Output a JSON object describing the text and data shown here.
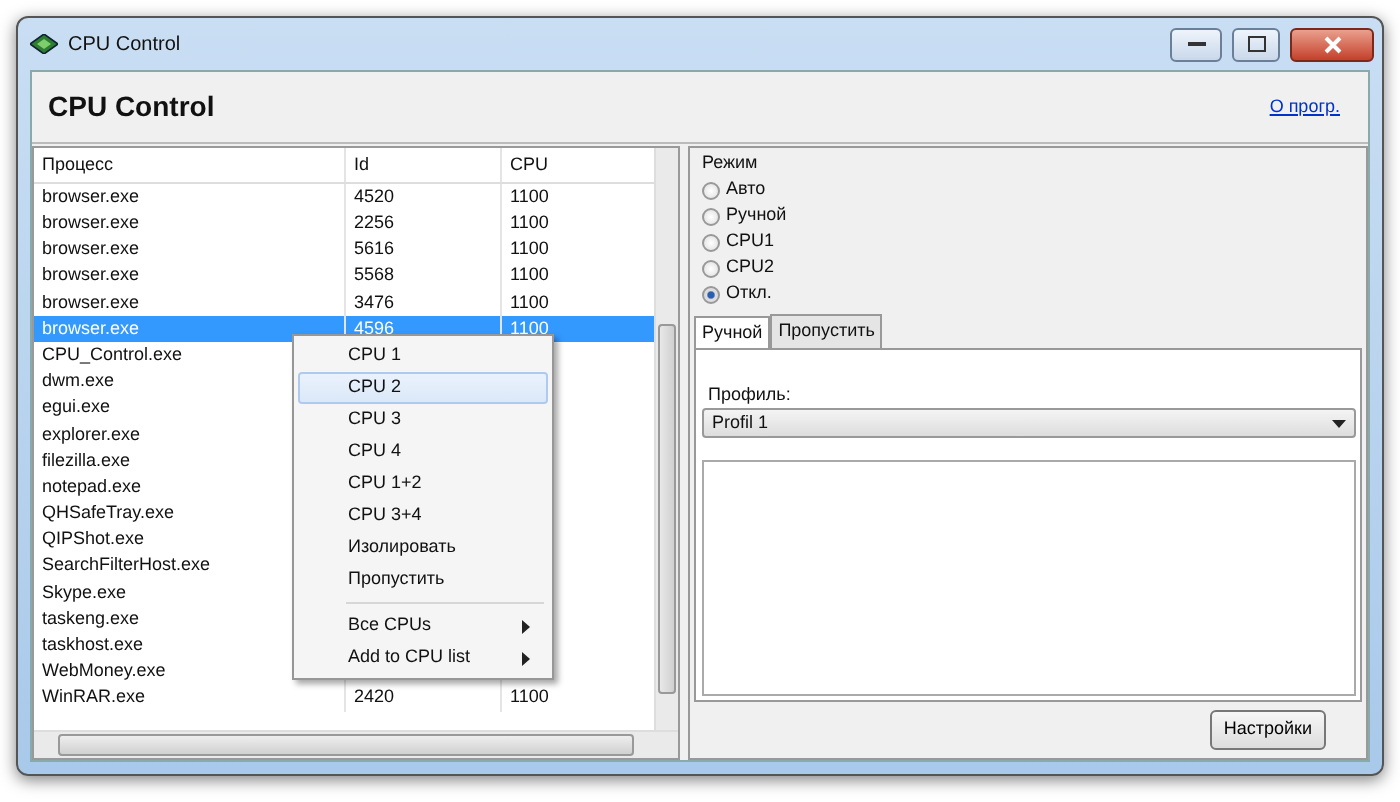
{
  "window": {
    "title": "CPU Control"
  },
  "header": {
    "title": "CPU Control",
    "link": "О прогр."
  },
  "process_table": {
    "columns": [
      "Процесс",
      "Id",
      "CPU"
    ],
    "rows": [
      {
        "name": "browser.exe",
        "id": "4520",
        "cpu": "1100",
        "selected": false
      },
      {
        "name": "browser.exe",
        "id": "2256",
        "cpu": "1100",
        "selected": false
      },
      {
        "name": "browser.exe",
        "id": "5616",
        "cpu": "1100",
        "selected": false
      },
      {
        "name": "browser.exe",
        "id": "5568",
        "cpu": "1100",
        "selected": false
      },
      {
        "name": "browser.exe",
        "id": "3476",
        "cpu": "1100",
        "selected": false
      },
      {
        "name": "browser.exe",
        "id": "4596",
        "cpu": "1100",
        "selected": true
      },
      {
        "name": "CPU_Control.exe",
        "selected": false
      },
      {
        "name": "dwm.exe",
        "selected": false
      },
      {
        "name": "egui.exe",
        "selected": false
      },
      {
        "name": "explorer.exe",
        "selected": false
      },
      {
        "name": "filezilla.exe",
        "selected": false
      },
      {
        "name": "notepad.exe",
        "selected": false
      },
      {
        "name": "QHSafeTray.exe",
        "selected": false
      },
      {
        "name": "QIPShot.exe",
        "selected": false
      },
      {
        "name": "SearchFilterHost.exe",
        "selected": false
      },
      {
        "name": "Skype.exe",
        "selected": false
      },
      {
        "name": "taskeng.exe",
        "selected": false
      },
      {
        "name": "taskhost.exe",
        "selected": false
      },
      {
        "name": "WebMoney.exe",
        "selected": false
      },
      {
        "name": "WinRAR.exe",
        "id": "2420",
        "cpu": "1100",
        "selected": false
      }
    ]
  },
  "context_menu": {
    "items": [
      {
        "kind": "item",
        "label": "CPU 1",
        "highlighted": false
      },
      {
        "kind": "item",
        "label": "CPU 2",
        "highlighted": true
      },
      {
        "kind": "item",
        "label": "CPU 3",
        "highlighted": false
      },
      {
        "kind": "item",
        "label": "CPU 4",
        "highlighted": false
      },
      {
        "kind": "item",
        "label": "CPU 1+2",
        "highlighted": false
      },
      {
        "kind": "item",
        "label": "CPU 3+4",
        "highlighted": false
      },
      {
        "kind": "item",
        "label": "Изолировать",
        "highlighted": false
      },
      {
        "kind": "item",
        "label": "Пропустить",
        "highlighted": false
      },
      {
        "kind": "separator"
      },
      {
        "kind": "submenu",
        "label": "Все CPUs",
        "highlighted": false
      },
      {
        "kind": "submenu",
        "label": "Add to CPU list",
        "highlighted": false
      }
    ]
  },
  "mode": {
    "label": "Режим",
    "options": [
      {
        "label": "Авто",
        "selected": false
      },
      {
        "label": "Ручной",
        "selected": false
      },
      {
        "label": "CPU1",
        "selected": false
      },
      {
        "label": "CPU2",
        "selected": false
      },
      {
        "label": "Откл.",
        "selected": true
      }
    ]
  },
  "tabs": [
    {
      "label": "Ручной",
      "selected": true
    },
    {
      "label": "Пропустить",
      "selected": false
    }
  ],
  "profile": {
    "label": "Профиль:",
    "value": "Profil 1"
  },
  "settings_button": "Настройки"
}
